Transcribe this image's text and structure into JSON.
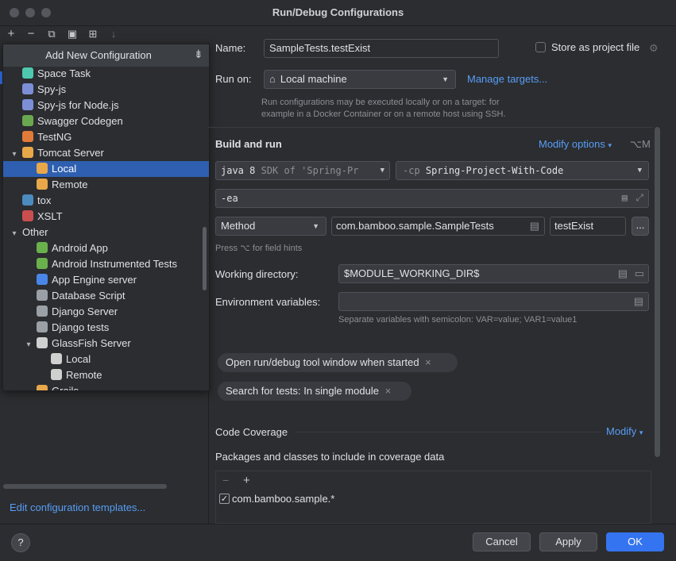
{
  "window": {
    "title": "Run/Debug Configurations"
  },
  "toolbar": {
    "add": "+",
    "remove": "−",
    "copy": "⧉",
    "save": "▣",
    "folder": "⊞",
    "sort": "↓"
  },
  "popup": {
    "title": "Add New Configuration",
    "items": [
      {
        "label": "Space Task",
        "indent": 0,
        "arrow": "",
        "icon": "space-icon",
        "color": "#4ec9b0"
      },
      {
        "label": "Spy-js",
        "indent": 0,
        "arrow": "",
        "icon": "spy-icon",
        "color": "#7c8fd6"
      },
      {
        "label": "Spy-js for Node.js",
        "indent": 0,
        "arrow": "",
        "icon": "spy-node-icon",
        "color": "#7c8fd6"
      },
      {
        "label": "Swagger Codegen",
        "indent": 0,
        "arrow": "",
        "icon": "swagger-icon",
        "color": "#6aa84f"
      },
      {
        "label": "TestNG",
        "indent": 0,
        "arrow": "",
        "icon": "testng-icon",
        "color": "#e07b39"
      },
      {
        "label": "Tomcat Server",
        "indent": 0,
        "arrow": "▾",
        "icon": "tomcat-icon",
        "color": "#e8a84a"
      },
      {
        "label": "Local",
        "indent": 1,
        "arrow": "",
        "icon": "tomcat-icon",
        "color": "#e8a84a",
        "selected": true
      },
      {
        "label": "Remote",
        "indent": 1,
        "arrow": "",
        "icon": "tomcat-icon",
        "color": "#e8a84a"
      },
      {
        "label": "tox",
        "indent": 0,
        "arrow": "",
        "icon": "python-icon",
        "color": "#4b8bbe"
      },
      {
        "label": "XSLT",
        "indent": 0,
        "arrow": "",
        "icon": "xslt-icon",
        "color": "#c94f4f"
      },
      {
        "label": "Other",
        "indent": 0,
        "arrow": "▾",
        "icon": "",
        "color": ""
      },
      {
        "label": "Android App",
        "indent": 1,
        "arrow": "",
        "icon": "android-icon",
        "color": "#6ab04c"
      },
      {
        "label": "Android Instrumented Tests",
        "indent": 1,
        "arrow": "",
        "icon": "android-icon",
        "color": "#6ab04c"
      },
      {
        "label": "App Engine server",
        "indent": 1,
        "arrow": "",
        "icon": "appengine-icon",
        "color": "#4a86e8"
      },
      {
        "label": "Database Script",
        "indent": 1,
        "arrow": "",
        "icon": "database-icon",
        "color": "#9aa0a6"
      },
      {
        "label": "Django Server",
        "indent": 1,
        "arrow": "",
        "icon": "django-icon",
        "color": "#9aa0a6"
      },
      {
        "label": "Django tests",
        "indent": 1,
        "arrow": "",
        "icon": "django-icon",
        "color": "#9aa0a6"
      },
      {
        "label": "GlassFish Server",
        "indent": 1,
        "arrow": "▾",
        "icon": "glassfish-icon",
        "color": "#d0d0d0"
      },
      {
        "label": "Local",
        "indent": 2,
        "arrow": "",
        "icon": "glassfish-icon",
        "color": "#d0d0d0"
      },
      {
        "label": "Remote",
        "indent": 2,
        "arrow": "",
        "icon": "glassfish-icon",
        "color": "#d0d0d0"
      },
      {
        "label": "Grails",
        "indent": 1,
        "arrow": "",
        "icon": "grails-icon",
        "color": "#e8a84a"
      }
    ]
  },
  "left": {
    "edit_templates": "Edit configuration templates..."
  },
  "form": {
    "name_label": "Name:",
    "name_value": "SampleTests.testExist",
    "store_label": "Store as project file",
    "runon_label": "Run on:",
    "runon_value": "Local machine",
    "manage_targets": "Manage targets...",
    "runon_hint": "Run configurations may be executed locally or on a target: for example in a Docker Container or on a remote host using SSH.",
    "build_title": "Build and run",
    "modify_options": "Modify options",
    "modify_shortcut": "⌥M",
    "jdk_prefix": "java 8",
    "jdk_value": "SDK of 'Spring-Pr",
    "cp_prefix": "-cp",
    "cp_value": "Spring-Project-With-Code",
    "vm_options": "-ea",
    "test_kind": "Method",
    "class_value": "com.bamboo.sample.SampleTests",
    "method_value": "testExist",
    "more_button": "...",
    "field_hint": "Press ⌥ for field hints",
    "workdir_label": "Working directory:",
    "workdir_value": "$MODULE_WORKING_DIR$",
    "env_label": "Environment variables:",
    "env_value": "",
    "env_hint": "Separate variables with semicolon: VAR=value; VAR1=value1",
    "tag1": "Open run/debug tool window when started",
    "tag2": "Search for tests: In single module",
    "coverage_title": "Code Coverage",
    "coverage_modify": "Modify",
    "coverage_packages": "Packages and classes to include in coverage data",
    "coverage_item": "com.bamboo.sample.*"
  },
  "buttons": {
    "help": "?",
    "cancel": "Cancel",
    "apply": "Apply",
    "ok": "OK"
  }
}
